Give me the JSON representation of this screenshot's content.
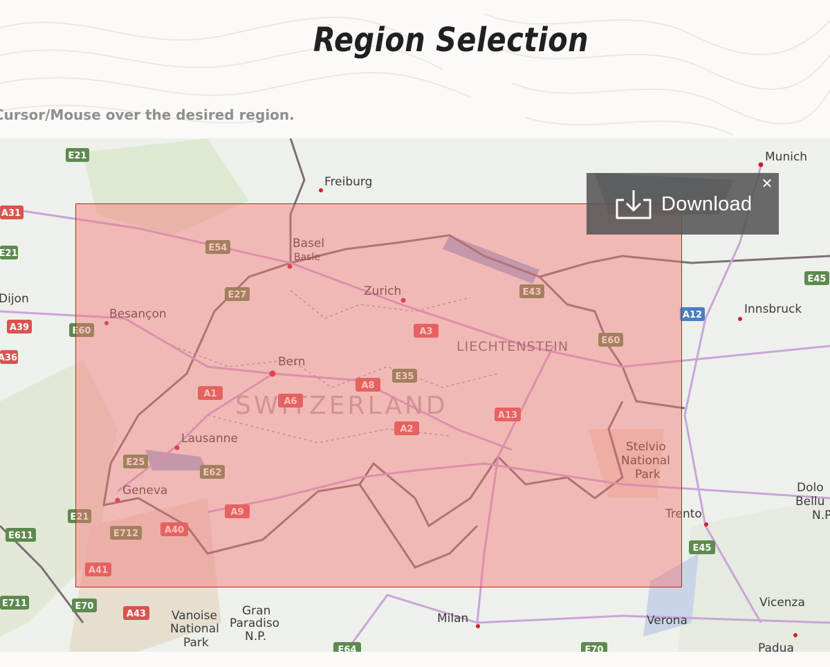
{
  "page": {
    "title": "Region Selection",
    "instruction": "r Cursor/Mouse over the desired region."
  },
  "download_panel": {
    "label": "Download",
    "close_glyph": "✕",
    "icon": "download-icon"
  },
  "colors": {
    "selection_fill": "#f47676",
    "selection_border": "#e01010",
    "panel_bg": "#555555",
    "route_shield_green": "#5d8a4e",
    "route_shield_red": "#d9534f",
    "route_shield_blue": "#4a7fc1"
  },
  "map": {
    "country_label": "SWITZERLAND",
    "region_label": "LIECHTENSTEIN",
    "cities": [
      "Munich",
      "Freiburg",
      "Basel",
      "Basle",
      "Zurich",
      "Besançon",
      "Dijon",
      "Innsbruck",
      "Bern",
      "Lausanne",
      "Geneva",
      "Stelvio",
      "National",
      "Park",
      "Trento",
      "Dolo",
      "Bellu",
      "N.P.",
      "Vanoise",
      "National",
      "Park",
      "Gran",
      "Paradiso",
      "N.P.",
      "Milan",
      "Verona",
      "Vicenza",
      "Padua"
    ],
    "route_shields": [
      "E21",
      "A31",
      "E54",
      "E21",
      "E27",
      "A39",
      "E60",
      "A36",
      "A12",
      "E45",
      "E43",
      "A3",
      "E60",
      "E35",
      "A8",
      "A1",
      "A6",
      "A13",
      "A2",
      "E25",
      "E62",
      "A9",
      "E21",
      "E712",
      "A40",
      "E611",
      "A41",
      "E711",
      "E70",
      "A43",
      "E64",
      "E70",
      "E45"
    ]
  }
}
